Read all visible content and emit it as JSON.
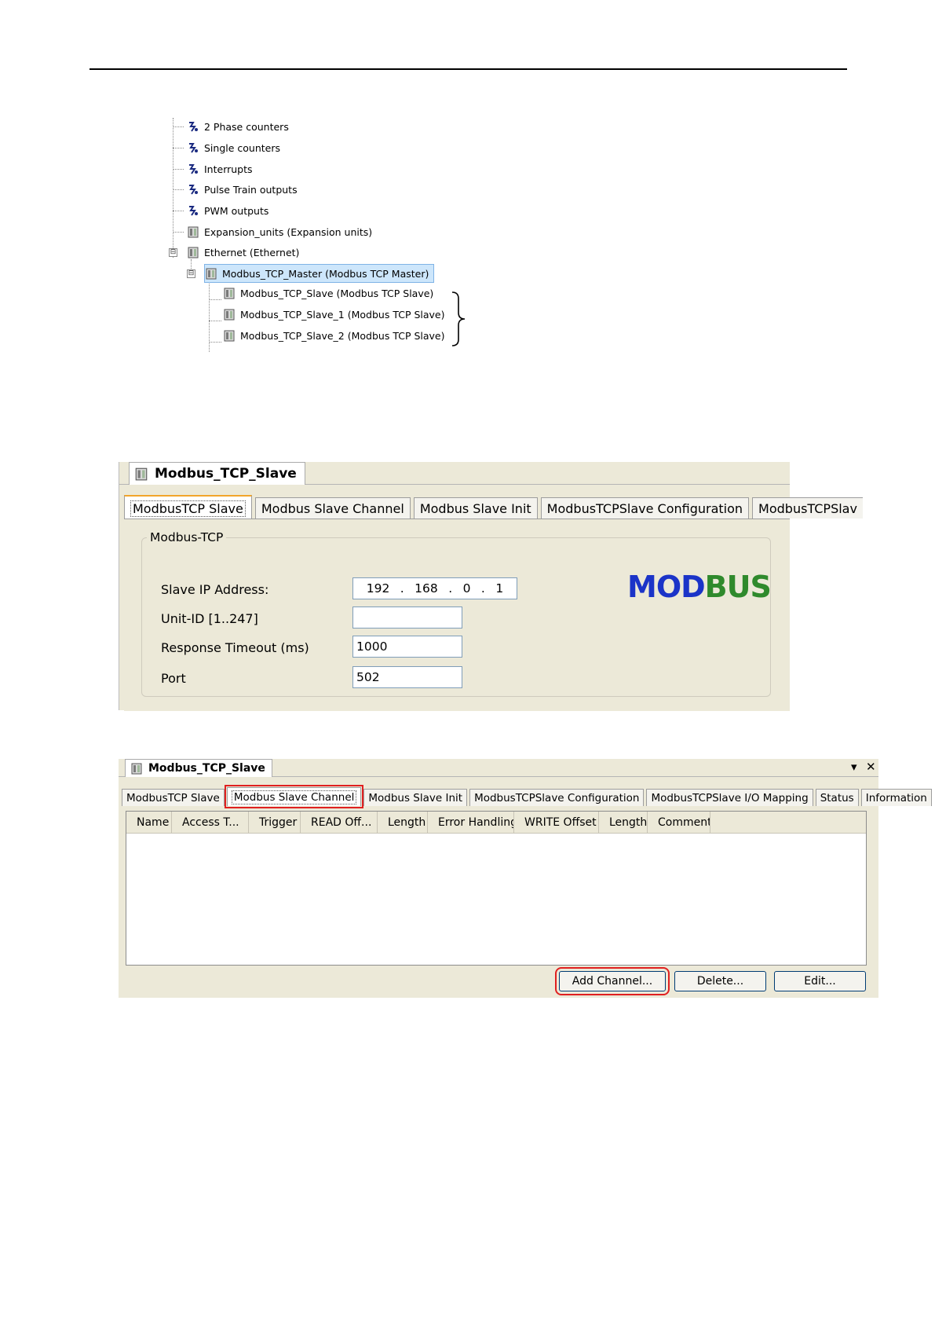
{
  "tree": {
    "items": [
      {
        "label": "2 Phase counters",
        "icon": "counter-icon"
      },
      {
        "label": "Single counters",
        "icon": "counter-icon"
      },
      {
        "label": "Interrupts",
        "icon": "counter-icon"
      },
      {
        "label": "Pulse Train outputs",
        "icon": "counter-icon"
      },
      {
        "label": "PWM outputs",
        "icon": "counter-icon"
      },
      {
        "label": "Expansion_units (Expansion units)",
        "icon": "device-icon"
      },
      {
        "label": "Ethernet (Ethernet)",
        "icon": "device-icon",
        "expander": "⊟"
      },
      {
        "label": "Modbus_TCP_Master (Modbus TCP Master)",
        "icon": "device-icon",
        "expander": "⊟",
        "selected": true
      },
      {
        "label": "Modbus_TCP_Slave (Modbus TCP Slave)",
        "icon": "device-icon"
      },
      {
        "label": "Modbus_TCP_Slave_1 (Modbus TCP Slave)",
        "icon": "device-icon"
      },
      {
        "label": "Modbus_TCP_Slave_2 (Modbus TCP Slave)",
        "icon": "device-icon"
      }
    ]
  },
  "panel1": {
    "title": "Modbus_TCP_Slave",
    "tabs": [
      "ModbusTCP Slave",
      "Modbus Slave Channel",
      "Modbus Slave Init",
      "ModbusTCPSlave Configuration",
      "ModbusTCPSlav"
    ],
    "group_title": "Modbus-TCP",
    "logo": {
      "part1": "MOD",
      "part2": "BUS",
      "color_blue": "#1b34c8",
      "color_green": "#2f8a2c"
    },
    "fields": {
      "ip_label": "Slave IP Address:",
      "ip": [
        "192",
        "168",
        "0",
        "1"
      ],
      "unit_label": "Unit-ID [1..247]",
      "unit_value": "",
      "timeout_label": "Response Timeout (ms)",
      "timeout_value": "1000",
      "port_label": "Port",
      "port_value": "502"
    }
  },
  "panel2": {
    "title": "Modbus_TCP_Slave",
    "controls": {
      "dropdown": "▾",
      "close": "✕"
    },
    "tabs": [
      "ModbusTCP Slave",
      "Modbus Slave Channel",
      "Modbus Slave Init",
      "ModbusTCPSlave Configuration",
      "ModbusTCPSlave I/O Mapping",
      "Status",
      "Information"
    ],
    "columns": [
      "Name",
      "Access T...",
      "Trigger",
      "READ Off...",
      "Length",
      "Error Handling",
      "WRITE Offset",
      "Length",
      "Comment"
    ],
    "buttons": {
      "add": "Add Channel...",
      "delete": "Delete...",
      "edit": "Edit..."
    }
  }
}
